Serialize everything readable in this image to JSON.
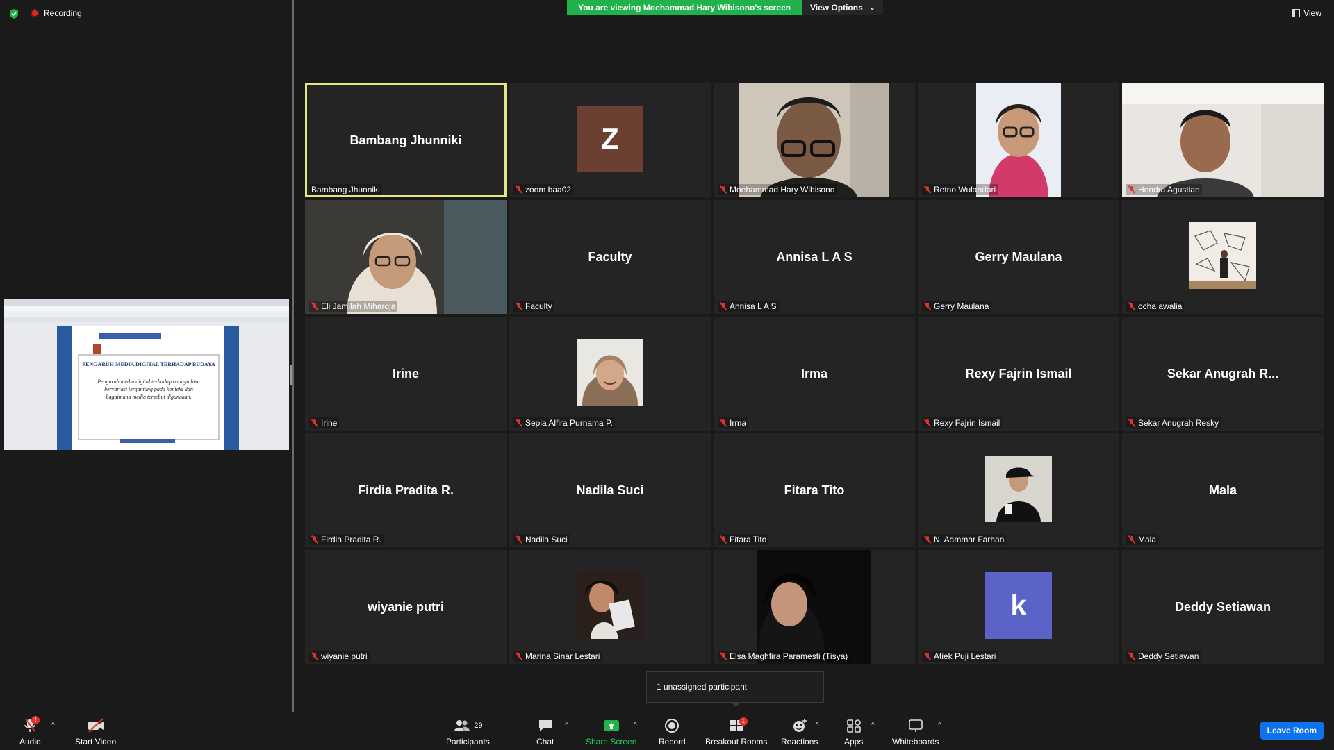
{
  "status": {
    "recording_label": "Recording"
  },
  "banner": {
    "viewing_text": "You are viewing Moehammad Hary Wibisono's screen",
    "view_options_label": "View Options"
  },
  "view_label": "View",
  "shared_slide": {
    "title": "PENGARUH MEDIA DIGITAL TERHADAP BUDAYA",
    "body": "Pengaruh media digital terhadap budaya bisa bervariasi tergantung pada konteks dan bagaimana media tersebut digunakan."
  },
  "participants": [
    {
      "center": "Bambang Jhunniki",
      "name": "Bambang Jhunniki",
      "muted": false,
      "active": true
    },
    {
      "center": "",
      "name": "zoom baa02",
      "muted": true,
      "avatar_letter": "Z",
      "avatar_color": "#6b4033"
    },
    {
      "center": "",
      "name": "Moehammad Hary Wibisono",
      "muted": true,
      "video": "man-glasses"
    },
    {
      "center": "",
      "name": "Retno Wulandari",
      "muted": true,
      "video": "woman-glasses"
    },
    {
      "center": "",
      "name": "Hendra Agustian",
      "muted": true,
      "video": "man-office"
    },
    {
      "center": "",
      "name": "Eli Jamilah Mihardja",
      "muted": true,
      "video": "woman-hijab"
    },
    {
      "center": "Faculty",
      "name": "Faculty",
      "muted": true
    },
    {
      "center": "Annisa L A S",
      "name": "Annisa L A S",
      "muted": true
    },
    {
      "center": "Gerry Maulana",
      "name": "Gerry Maulana",
      "muted": true
    },
    {
      "center": "",
      "name": "ocha awalia",
      "muted": true,
      "avatar_photo": "mural"
    },
    {
      "center": "Irine",
      "name": "Irine",
      "muted": true
    },
    {
      "center": "",
      "name": "Sepia Alfira Purnama P.",
      "muted": true,
      "avatar_photo": "hijab-portrait"
    },
    {
      "center": "Irma",
      "name": "Irma",
      "muted": true
    },
    {
      "center": "Rexy Fajrin Ismail",
      "name": "Rexy Fajrin Ismail",
      "muted": true
    },
    {
      "center": "Sekar Anugrah R...",
      "name": "Sekar Anugrah Resky",
      "muted": true
    },
    {
      "center": "Firdia Pradita R.",
      "name": "Firdia Pradita R.",
      "muted": true
    },
    {
      "center": "Nadila Suci",
      "name": "Nadila Suci",
      "muted": true
    },
    {
      "center": "Fitara Tito",
      "name": "Fitara Tito",
      "muted": true
    },
    {
      "center": "",
      "name": "N. Aammar Farhan",
      "muted": true,
      "avatar_photo": "cap-portrait"
    },
    {
      "center": "Mala",
      "name": "Mala",
      "muted": true
    },
    {
      "center": "wiyanie putri",
      "name": "wiyanie putri",
      "muted": true
    },
    {
      "center": "",
      "name": "Marina Sinar Lestari",
      "muted": true,
      "avatar_photo": "selfie"
    },
    {
      "center": "",
      "name": "Elsa Maghfira Paramesti (Tisya)",
      "muted": true,
      "video": "dark-hijab"
    },
    {
      "center": "",
      "name": "Atiek Puji Lestari",
      "muted": true,
      "avatar_letter": "k",
      "avatar_color": "#5b62c8"
    },
    {
      "center": "Deddy Setiawan",
      "name": "Deddy Setiawan",
      "muted": true
    }
  ],
  "tooltip": {
    "text": "1 unassigned participant"
  },
  "toolbar": {
    "audio": "Audio",
    "start_video": "Start Video",
    "participants": "Participants",
    "participants_count": "29",
    "chat": "Chat",
    "share_screen": "Share Screen",
    "record": "Record",
    "breakout_rooms": "Breakout Rooms",
    "breakout_badge": "1",
    "audio_badge": "!",
    "reactions": "Reactions",
    "apps": "Apps",
    "whiteboards": "Whiteboards",
    "leave_room": "Leave Room"
  },
  "colors": {
    "active_speaker": "#e2e783",
    "share_banner": "#22b24c",
    "leave_button": "#0e72ed",
    "mute": "#e0322d"
  }
}
